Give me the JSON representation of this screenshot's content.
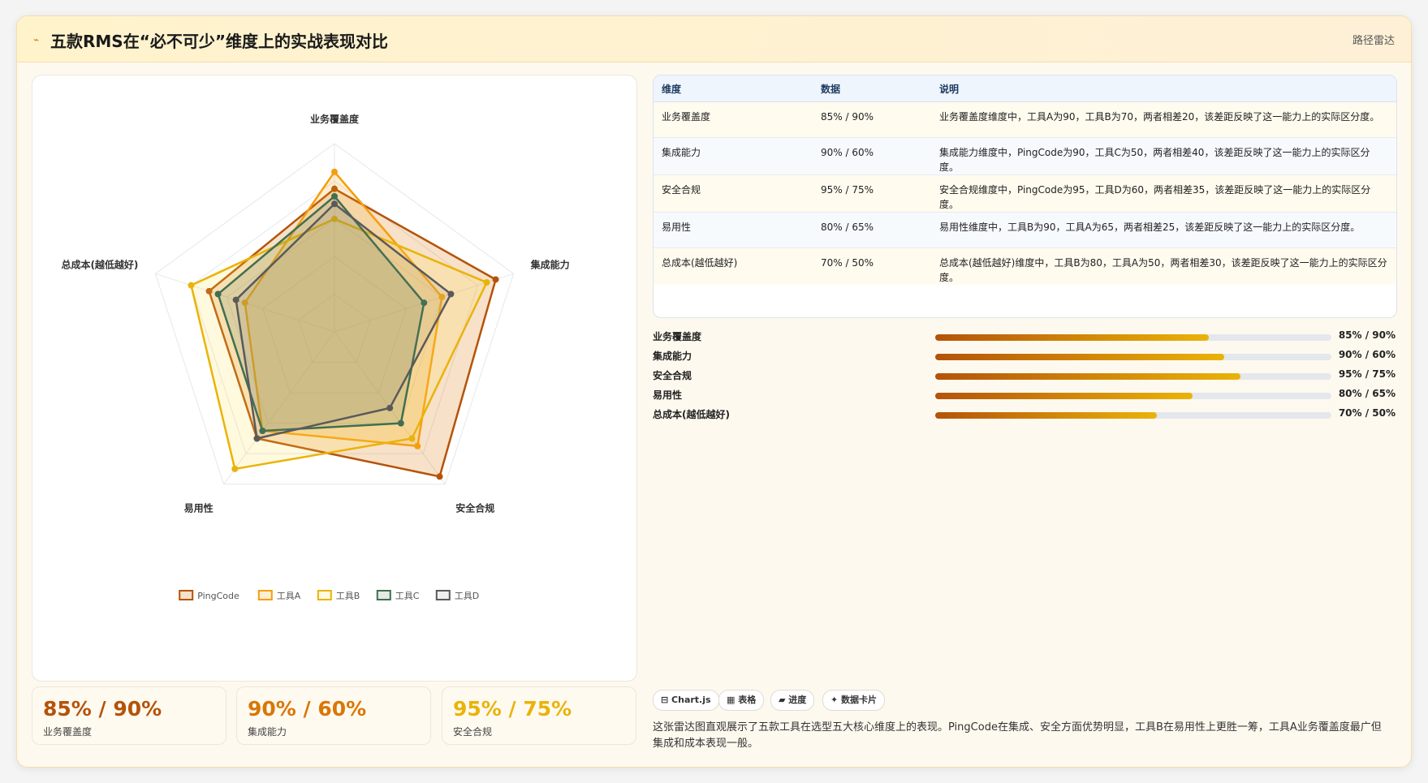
{
  "header": {
    "icon": "chart-icon",
    "title": "五款RMS在“必不可少”维度上的实战表现对比",
    "tag": "路径雷达"
  },
  "chart_data": {
    "type": "radar",
    "axes": [
      "业务覆盖度",
      "集成能力",
      "安全合规",
      "易用性",
      "总成本(越低越好)"
    ],
    "range": [
      0,
      100
    ],
    "grid_levels": 5,
    "legend_position": "bottom",
    "series": [
      {
        "name": "PingCode",
        "values": [
          76,
          90,
          95,
          70,
          70
        ],
        "color": "#b45309",
        "fill": "rgba(217,119,6,0.22)"
      },
      {
        "name": "工具A",
        "values": [
          85,
          60,
          75,
          65,
          50
        ],
        "color": "#f59e0b",
        "fill": "rgba(245,158,11,0.18)"
      },
      {
        "name": "工具B",
        "values": [
          60,
          85,
          70,
          90,
          80
        ],
        "color": "#eab308",
        "fill": "rgba(253,224,71,0.18)"
      },
      {
        "name": "工具C",
        "values": [
          72,
          50,
          60,
          65,
          65
        ],
        "color": "#3f6f4f",
        "fill": "rgba(63,111,79,0.15)"
      },
      {
        "name": "工具D",
        "values": [
          68,
          65,
          50,
          70,
          55
        ],
        "color": "#5a5a5a",
        "fill": "rgba(120,120,120,0.12)"
      }
    ]
  },
  "table": {
    "headers": [
      "维度",
      "数据",
      "说明"
    ],
    "rows": [
      {
        "dim": "业务覆盖度",
        "data": "85% / 90%",
        "desc": "业务覆盖度维度中，工具A为90，工具B为70，两者相差20，该差距反映了这一能力上的实际区分度。"
      },
      {
        "dim": "集成能力",
        "data": "90% / 60%",
        "desc": "集成能力维度中，PingCode为90，工具C为50，两者相差40，该差距反映了这一能力上的实际区分度。"
      },
      {
        "dim": "安全合规",
        "data": "95% / 75%",
        "desc": "安全合规维度中，PingCode为95，工具D为60，两者相差35，该差距反映了这一能力上的实际区分度。"
      },
      {
        "dim": "易用性",
        "data": "80% / 65%",
        "desc": "易用性维度中，工具B为90，工具A为65，两者相差25，该差距反映了这一能力上的实际区分度。"
      },
      {
        "dim": "总成本(越低越好)",
        "data": "70% / 50%",
        "desc": "总成本(越低越好)维度中，工具B为80，工具A为50，两者相差30，该差距反映了这一能力上的实际区分度。"
      }
    ]
  },
  "progress": [
    {
      "label": "业务覆盖度",
      "value": "85% / 90%",
      "fill_percent": 69
    },
    {
      "label": "集成能力",
      "value": "90% / 60%",
      "fill_percent": 73
    },
    {
      "label": "安全合规",
      "value": "95% / 75%",
      "fill_percent": 77
    },
    {
      "label": "易用性",
      "value": "80% / 65%",
      "fill_percent": 65
    },
    {
      "label": "总成本(越低越好)",
      "value": "70% / 50%",
      "fill_percent": 56
    }
  ],
  "kpis": [
    {
      "value": "85% / 90%",
      "label": "业务覆盖度",
      "color": "#b45309"
    },
    {
      "value": "90% / 60%",
      "label": "集成能力",
      "color": "#d97706"
    },
    {
      "value": "95% / 75%",
      "label": "安全合规",
      "color": "#eab308"
    }
  ],
  "chips": [
    {
      "icon": "chart-icon",
      "label": "⊟ Chart.js"
    },
    {
      "icon": "table-icon",
      "label": "▦ 表格"
    },
    {
      "icon": "progress-icon",
      "label": "▰ 进度"
    },
    {
      "icon": "card-icon",
      "label": "✦ 数据卡片"
    }
  ],
  "summary": "这张雷达图直观展示了五款工具在选型五大核心维度上的表现。PingCode在集成、安全方面优势明显，工具B在易用性上更胜一筹，工具A业务覆盖度最广但集成和成本表现一般。"
}
